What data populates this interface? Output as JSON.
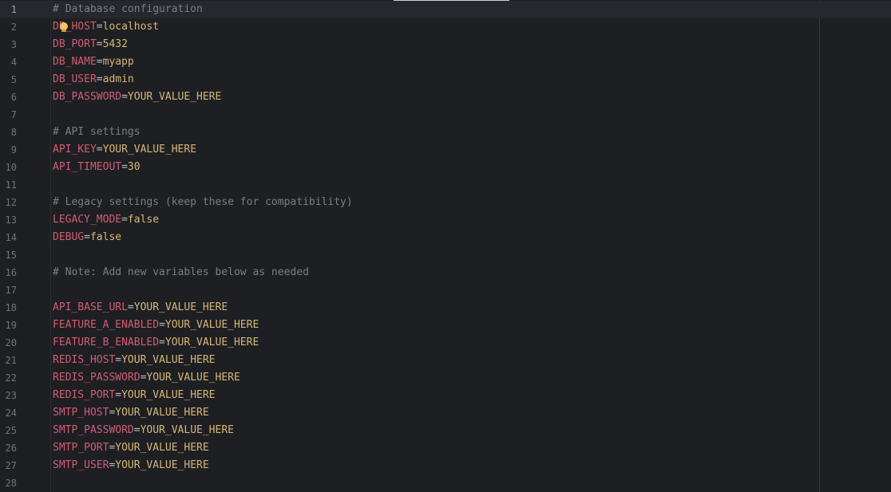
{
  "editor": {
    "current_line": 1,
    "lines": [
      {
        "n": "1",
        "type": "comment",
        "text": "# Database configuration"
      },
      {
        "n": "2",
        "type": "kv",
        "key": "DB_HOST",
        "value": "localhost"
      },
      {
        "n": "3",
        "type": "kv",
        "key": "DB_PORT",
        "value": "5432"
      },
      {
        "n": "4",
        "type": "kv",
        "key": "DB_NAME",
        "value": "myapp"
      },
      {
        "n": "5",
        "type": "kv",
        "key": "DB_USER",
        "value": "admin"
      },
      {
        "n": "6",
        "type": "kv",
        "key": "DB_PASSWORD",
        "value": "YOUR_VALUE_HERE"
      },
      {
        "n": "7",
        "type": "empty"
      },
      {
        "n": "8",
        "type": "comment",
        "text": "# API settings"
      },
      {
        "n": "9",
        "type": "kv",
        "key": "API_KEY",
        "value": "YOUR_VALUE_HERE"
      },
      {
        "n": "10",
        "type": "kv",
        "key": "API_TIMEOUT",
        "value": "30"
      },
      {
        "n": "11",
        "type": "empty"
      },
      {
        "n": "12",
        "type": "comment",
        "text": "# Legacy settings (keep these for compatibility)"
      },
      {
        "n": "13",
        "type": "kv",
        "key": "LEGACY_MODE",
        "value": "false"
      },
      {
        "n": "14",
        "type": "kv",
        "key": "DEBUG",
        "value": "false"
      },
      {
        "n": "15",
        "type": "empty"
      },
      {
        "n": "16",
        "type": "comment",
        "text": "# Note: Add new variables below as needed"
      },
      {
        "n": "17",
        "type": "empty"
      },
      {
        "n": "18",
        "type": "kv",
        "key": "API_BASE_URL",
        "value": "YOUR_VALUE_HERE"
      },
      {
        "n": "19",
        "type": "kv",
        "key": "FEATURE_A_ENABLED",
        "value": "YOUR_VALUE_HERE"
      },
      {
        "n": "20",
        "type": "kv",
        "key": "FEATURE_B_ENABLED",
        "value": "YOUR_VALUE_HERE"
      },
      {
        "n": "21",
        "type": "kv",
        "key": "REDIS_HOST",
        "value": "YOUR_VALUE_HERE"
      },
      {
        "n": "22",
        "type": "kv",
        "key": "REDIS_PASSWORD",
        "value": "YOUR_VALUE_HERE"
      },
      {
        "n": "23",
        "type": "kv",
        "key": "REDIS_PORT",
        "value": "YOUR_VALUE_HERE"
      },
      {
        "n": "24",
        "type": "kv",
        "key": "SMTP_HOST",
        "value": "YOUR_VALUE_HERE"
      },
      {
        "n": "25",
        "type": "kv",
        "key": "SMTP_PASSWORD",
        "value": "YOUR_VALUE_HERE"
      },
      {
        "n": "26",
        "type": "kv",
        "key": "SMTP_PORT",
        "value": "YOUR_VALUE_HERE"
      },
      {
        "n": "27",
        "type": "kv",
        "key": "SMTP_USER",
        "value": "YOUR_VALUE_HERE"
      },
      {
        "n": "28",
        "type": "empty"
      }
    ],
    "separator": "=",
    "intention_icon": "lightbulb-icon",
    "colors": {
      "background": "#1e1f22",
      "comment": "#7a7e85",
      "key": "#cf5d74",
      "value": "#d5b778",
      "line_number": "#6f737a",
      "bulb": "#f2c55c"
    }
  }
}
